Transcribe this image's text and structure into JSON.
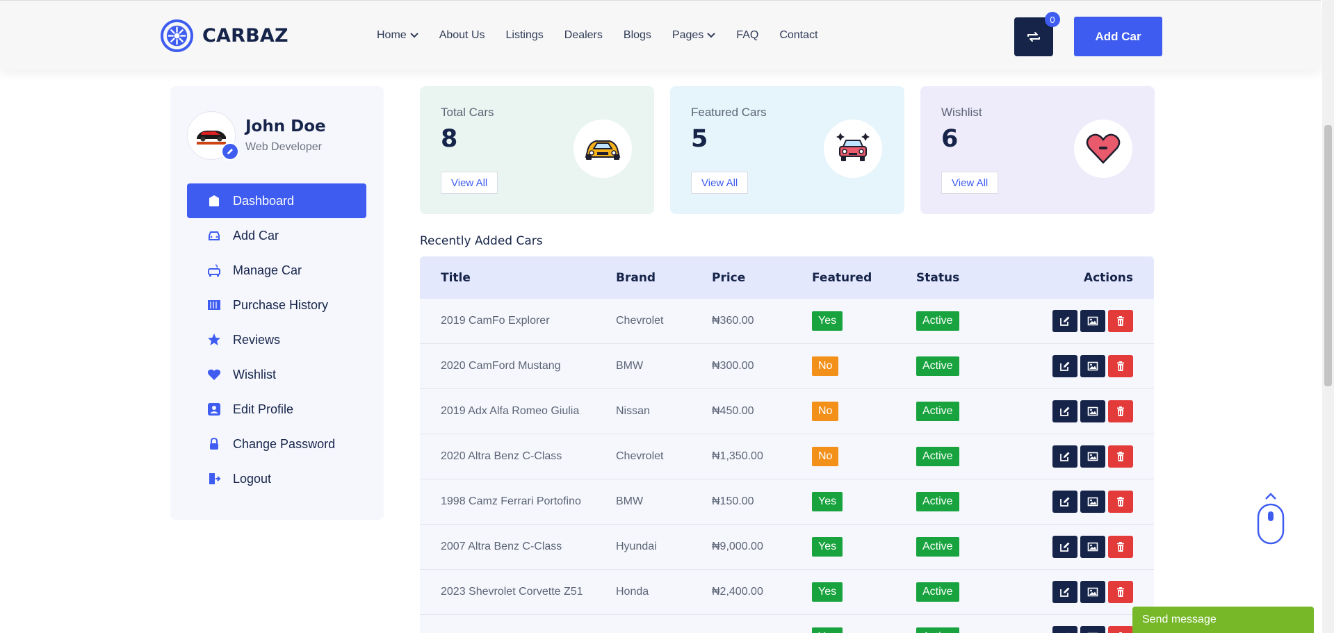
{
  "header": {
    "brand": "CARBAZ",
    "nav": [
      {
        "label": "Home",
        "dropdown": true
      },
      {
        "label": "About Us",
        "dropdown": false
      },
      {
        "label": "Listings",
        "dropdown": false
      },
      {
        "label": "Dealers",
        "dropdown": false
      },
      {
        "label": "Blogs",
        "dropdown": false
      },
      {
        "label": "Pages",
        "dropdown": true
      },
      {
        "label": "FAQ",
        "dropdown": false
      },
      {
        "label": "Contact",
        "dropdown": false
      }
    ],
    "compare_count": "0",
    "add_car_label": "Add Car"
  },
  "profile": {
    "name": "John Doe",
    "role": "Web Developer"
  },
  "sidebar": {
    "items": [
      {
        "label": "Dashboard",
        "icon": "dashboard-icon",
        "active": true
      },
      {
        "label": "Add Car",
        "icon": "car-icon"
      },
      {
        "label": "Manage Car",
        "icon": "manage-car-icon"
      },
      {
        "label": "Purchase History",
        "icon": "history-icon"
      },
      {
        "label": "Reviews",
        "icon": "star-icon"
      },
      {
        "label": "Wishlist",
        "icon": "heart-icon"
      },
      {
        "label": "Edit Profile",
        "icon": "user-icon"
      },
      {
        "label": "Change Password",
        "icon": "lock-icon"
      },
      {
        "label": "Logout",
        "icon": "logout-icon"
      }
    ]
  },
  "stats": [
    {
      "label": "Total Cars",
      "value": "8",
      "button": "View All",
      "bg": "#eaf5f1",
      "icon": "sports-car-icon"
    },
    {
      "label": "Featured Cars",
      "value": "5",
      "button": "View All",
      "bg": "#e6f4fb",
      "icon": "featured-car-icon"
    },
    {
      "label": "Wishlist",
      "value": "6",
      "button": "View All",
      "bg": "#eeebfa",
      "icon": "heart-icon"
    }
  ],
  "recent": {
    "title": "Recently Added Cars",
    "columns": [
      "Title",
      "Brand",
      "Price",
      "Featured",
      "Status",
      "Actions"
    ],
    "rows": [
      {
        "title": "2019 CamFo Explorer",
        "brand": "Chevrolet",
        "price": "₦360.00",
        "featured": "Yes",
        "status": "Active"
      },
      {
        "title": "2020 CamFord Mustang",
        "brand": "BMW",
        "price": "₦300.00",
        "featured": "No",
        "status": "Active"
      },
      {
        "title": "2019 Adx Alfa Romeo Giulia",
        "brand": "Nissan",
        "price": "₦450.00",
        "featured": "No",
        "status": "Active"
      },
      {
        "title": "2020 Altra Benz C-Class",
        "brand": "Chevrolet",
        "price": "₦1,350.00",
        "featured": "No",
        "status": "Active"
      },
      {
        "title": "1998 Camz Ferrari Portofino",
        "brand": "BMW",
        "price": "₦150.00",
        "featured": "Yes",
        "status": "Active"
      },
      {
        "title": "2007 Altra Benz C-Class",
        "brand": "Hyundai",
        "price": "₦9,000.00",
        "featured": "Yes",
        "status": "Active"
      },
      {
        "title": "2023 Shevrolet Corvette Z51",
        "brand": "Honda",
        "price": "₦2,400.00",
        "featured": "Yes",
        "status": "Active"
      },
      {
        "title": "",
        "brand": "",
        "price": "",
        "featured": "Yes",
        "status": "Active"
      }
    ]
  },
  "chat": {
    "label": "Send message"
  },
  "colors": {
    "primary": "#3e5cf0",
    "navy": "#16244a",
    "green": "#18a33e",
    "orange": "#f39019",
    "red": "#e33a3a",
    "chat": "#77b829"
  }
}
